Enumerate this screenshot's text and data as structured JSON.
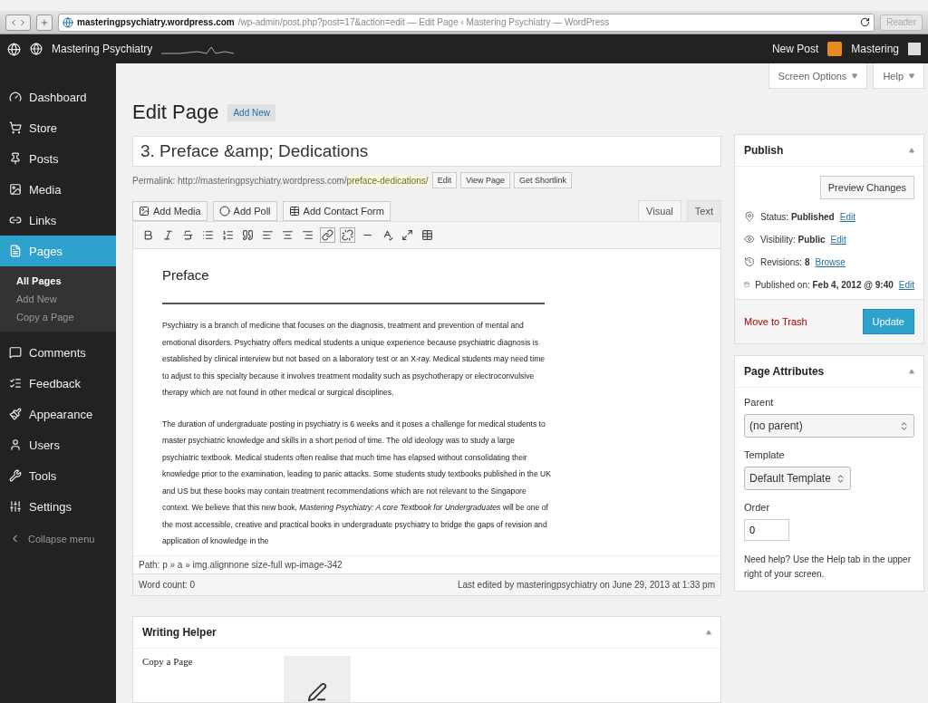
{
  "browser": {
    "url_domain": "masteringpsychiatry.wordpress.com",
    "url_path": "/wp-admin/post.php?post=17&action=edit — Edit Page ‹ Mastering Psychiatry — WordPress",
    "reader": "Reader"
  },
  "admin_bar": {
    "site": "Mastering Psychiatry",
    "new_post": "New Post",
    "user": "Mastering"
  },
  "sidebar": {
    "items": [
      {
        "kind": "dashboard",
        "label": "Dashboard",
        "selected": false
      },
      {
        "kind": "store",
        "label": "Store",
        "selected": false
      },
      {
        "kind": "posts",
        "label": "Posts",
        "selected": false
      },
      {
        "kind": "media",
        "label": "Media",
        "selected": false
      },
      {
        "kind": "links",
        "label": "Links",
        "selected": false
      },
      {
        "kind": "pages",
        "label": "Pages",
        "selected": true,
        "children": [
          {
            "label": "All Pages",
            "selected": true
          },
          {
            "label": "Add New",
            "selected": false
          },
          {
            "label": "Copy a Page",
            "selected": false
          }
        ]
      },
      {
        "kind": "comments",
        "label": "Comments",
        "selected": false
      },
      {
        "kind": "feedback",
        "label": "Feedback",
        "selected": false
      },
      {
        "kind": "appearance",
        "label": "Appearance",
        "selected": false
      },
      {
        "kind": "users",
        "label": "Users",
        "selected": false
      },
      {
        "kind": "tools",
        "label": "Tools",
        "selected": false
      },
      {
        "kind": "settings",
        "label": "Settings",
        "selected": false
      }
    ],
    "collapse": "Collapse menu"
  },
  "screen_tabs": [
    "Screen Options",
    "Help"
  ],
  "header": {
    "title": "Edit Page",
    "add_new": "Add New"
  },
  "post": {
    "title": "3. Preface &amp; Dedications",
    "permalink_label": "Permalink:",
    "permalink_base": "http://masteringpsychiatry.wordpress.com/",
    "permalink_slug": "preface-dedications/",
    "permalink_buttons": [
      "Edit",
      "View Page",
      "Get Shortlink"
    ]
  },
  "media_buttons": [
    {
      "kind": "media",
      "label": "Add Media"
    },
    {
      "kind": "poll",
      "label": "Add Poll"
    },
    {
      "kind": "form",
      "label": "Add Contact Form"
    }
  ],
  "editor_tabs": [
    {
      "label": "Visual",
      "selected": true
    },
    {
      "label": "Text",
      "selected": false
    }
  ],
  "content": {
    "heading": "Preface",
    "paragraphs": [
      "Psychiatry is a branch of medicine that focuses on the diagnosis, treatment and prevention of mental and emotional disorders.  Psychiatry offers medical students a unique experience because psychiatric diagnosis is established by clinical interview but not based on a laboratory test or an X-ray. Medical students may need time to adjust to this specialty because it involves treatment modality such as psychotherapy or electroconvulsive therapy which are not found in other medical or surgical disciplines.",
      "The duration of undergraduate posting in psychiatry is 6 weeks and it poses a challenge for medical students to master psychiatric knowledge and skills in a short period of time. The old ideology was to study a large psychiatric textbook. Medical students often realise that much time has elapsed without consolidating their knowledge prior to the examination, leading to panic attacks. Some students study textbooks published in the UK and US but these books may contain treatment recommendations which are not relevant to the Singapore context.  We believe that this new book, *Mastering Psychiatry: A core Textbook for Undergraduates*  will be one of the most accessible, creative and practical books in undergraduate psychiatry to bridge the gaps of revision and application of knowledge in the"
    ]
  },
  "path": "Path: p » a » img.alignnone size-full wp-image-342",
  "word_count": "Word count: 0",
  "last_edited": "Last edited by masteringpsychiatry on June 29, 2013 at 1:33 pm",
  "writing_helper": {
    "title": "Writing Helper",
    "item": "Copy a Page"
  },
  "publish": {
    "title": "Publish",
    "preview": "Preview Changes",
    "rows": [
      {
        "kind": "status",
        "label": "Status:",
        "value": "Published",
        "link": "Edit"
      },
      {
        "kind": "visibility",
        "label": "Visibility:",
        "value": "Public",
        "link": "Edit"
      },
      {
        "kind": "revisions",
        "label": "Revisions:",
        "value": "8",
        "link": "Browse"
      },
      {
        "kind": "date",
        "label": "Published on:",
        "value": "Feb 4, 2012 @ 9:40",
        "link": "Edit"
      }
    ],
    "trash": "Move to Trash",
    "update": "Update"
  },
  "page_attributes": {
    "title": "Page Attributes",
    "parent_label": "Parent",
    "parent_value": "(no parent)",
    "template_label": "Template",
    "template_value": "Default Template",
    "order_label": "Order",
    "order_value": "0",
    "help": "Need help? Use the Help tab in the upper right of your screen."
  }
}
